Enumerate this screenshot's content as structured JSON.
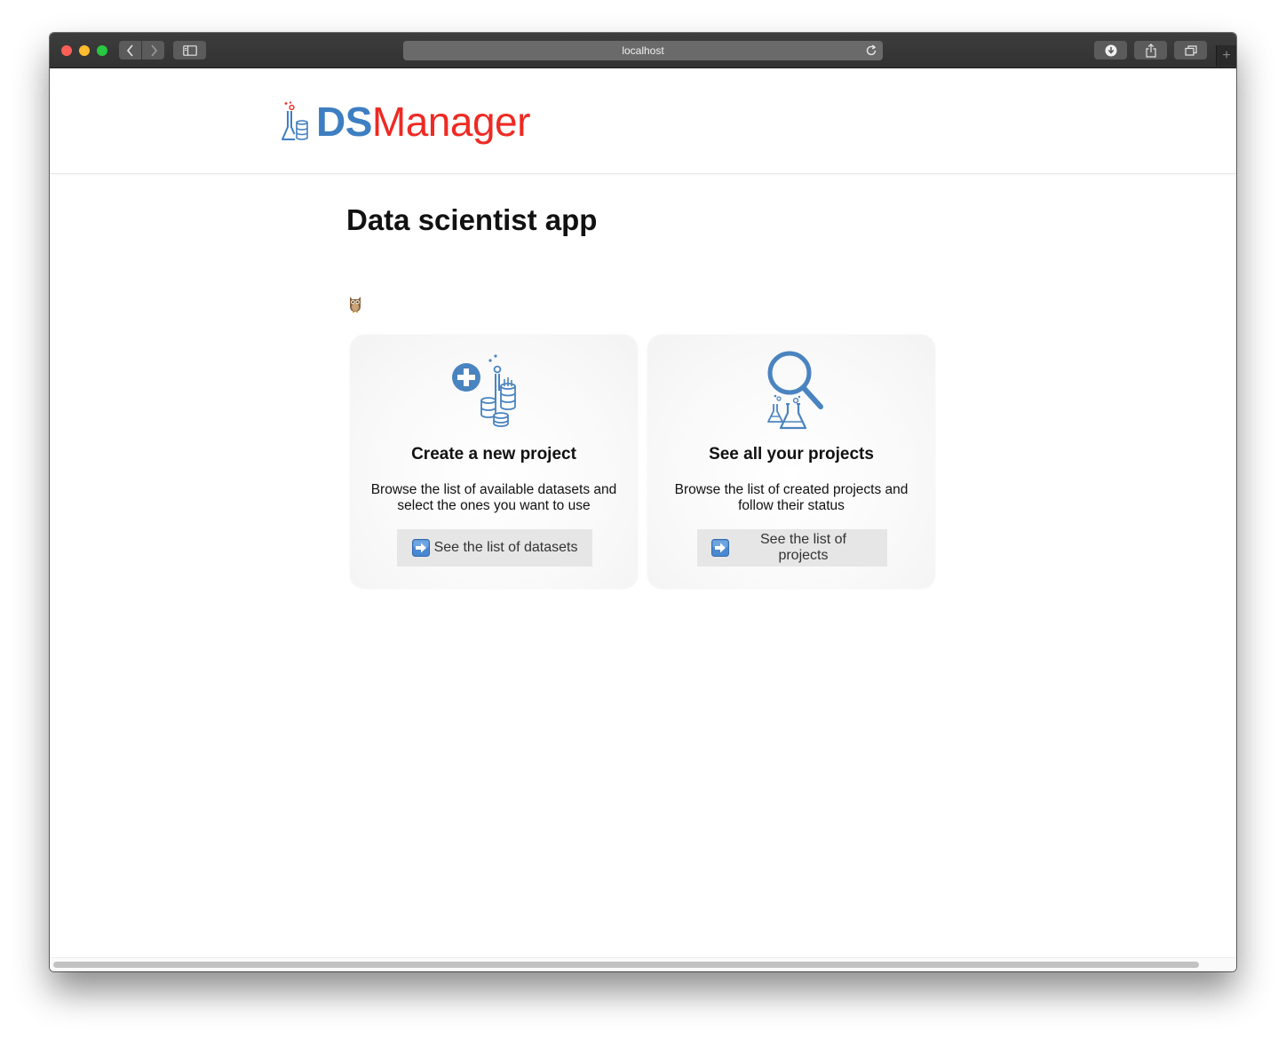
{
  "browser": {
    "url": "localhost",
    "icons": {
      "back": "chevron-left-icon",
      "forward": "chevron-right-icon",
      "sidebar": "sidebar-icon",
      "reload": "reload-icon",
      "downloads": "download-icon",
      "share": "share-icon",
      "tabs": "tabs-icon",
      "new_tab": "plus-icon"
    },
    "new_tab_label": "+"
  },
  "header": {
    "logo": {
      "part1": "DS",
      "part2": "Manager",
      "colors": {
        "part1": "#3e7ec2",
        "part2": "#ee2a24"
      }
    }
  },
  "main": {
    "title": "Data scientist app",
    "mascot_icon": "owl-icon",
    "cards": [
      {
        "icon": "add-dataset-icon",
        "title": "Create a new project",
        "description": "Browse the list of available datasets and select the ones you want to use",
        "button": {
          "icon": "arrow-right-icon",
          "label": "See the list of datasets"
        }
      },
      {
        "icon": "search-projects-icon",
        "title": "See all your projects",
        "description": "Browse the list of created projects and follow their status",
        "button": {
          "icon": "arrow-right-icon",
          "label": "See the list of projects"
        }
      }
    ]
  },
  "colors": {
    "accent_blue": "#3e7ec2",
    "accent_red": "#ee2a24",
    "button_bg": "#e6e6e6"
  }
}
